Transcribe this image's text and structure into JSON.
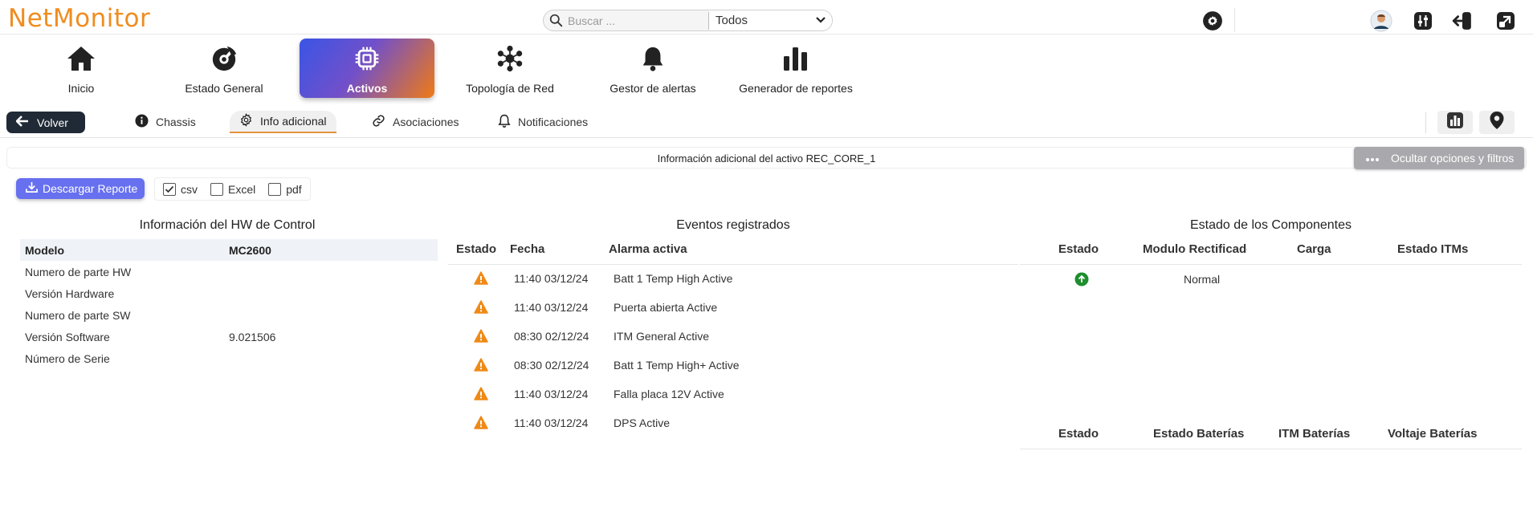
{
  "app": {
    "logo": "NetMonitor"
  },
  "search": {
    "placeholder": "Buscar ...",
    "filter": "Todos"
  },
  "nav": [
    {
      "label": "Inicio",
      "icon": "home-icon"
    },
    {
      "label": "Estado General",
      "icon": "gauge-icon"
    },
    {
      "label": "Activos",
      "icon": "chip-icon",
      "active": true
    },
    {
      "label": "Topología de Red",
      "icon": "network-icon"
    },
    {
      "label": "Gestor de alertas",
      "icon": "bell-icon"
    },
    {
      "label": "Generador de reportes",
      "icon": "bar-chart-icon"
    }
  ],
  "tabs": {
    "back": "Volver",
    "items": [
      {
        "label": "Chassis",
        "icon": "info-icon"
      },
      {
        "label": "Info adicional",
        "icon": "gear-icon",
        "active": true
      },
      {
        "label": "Asociaciones",
        "icon": "link-icon"
      },
      {
        "label": "Notificaciones",
        "icon": "bell-icon"
      }
    ]
  },
  "info": {
    "title": "Información adicional del activo REC_CORE_1",
    "hide_filters": "Ocultar opciones y filtros"
  },
  "export": {
    "download": "Descargar Reporte",
    "formats": [
      {
        "label": "csv",
        "checked": true
      },
      {
        "label": "Excel",
        "checked": false
      },
      {
        "label": "pdf",
        "checked": false
      }
    ]
  },
  "hw": {
    "title": "Información del HW de Control",
    "header": {
      "k": "Modelo",
      "v": "MC2600"
    },
    "rows": [
      {
        "k": "Numero de parte HW",
        "v": ""
      },
      {
        "k": "Versión Hardware",
        "v": ""
      },
      {
        "k": "Numero de parte SW",
        "v": ""
      },
      {
        "k": "Versión Software",
        "v": "9.021506"
      },
      {
        "k": "Número de Serie",
        "v": ""
      }
    ]
  },
  "events": {
    "title": "Eventos registrados",
    "columns": [
      "Estado",
      "Fecha",
      "Alarma activa"
    ],
    "rows": [
      {
        "fecha": "11:40 03/12/24",
        "alarma": "Batt 1 Temp High Active"
      },
      {
        "fecha": "11:40 03/12/24",
        "alarma": "Puerta abierta Active"
      },
      {
        "fecha": "08:30 02/12/24",
        "alarma": "ITM General Active"
      },
      {
        "fecha": "08:30 02/12/24",
        "alarma": "Batt 1 Temp High+ Active"
      },
      {
        "fecha": "11:40 03/12/24",
        "alarma": "Falla placa 12V Active"
      },
      {
        "fecha": "11:40 03/12/24",
        "alarma": "DPS Active"
      }
    ]
  },
  "components": {
    "title": "Estado de los Componentes",
    "columns1": [
      "Estado",
      "Modulo Rectificador",
      "Carga",
      "Estado ITMs"
    ],
    "row1": {
      "modulo": "Normal"
    },
    "columns2": [
      "Estado",
      "Estado Baterías",
      "ITM Baterías",
      "Voltaje Baterías"
    ]
  },
  "colors": {
    "brand": "#ef8d20",
    "warning": "#ef8a17",
    "ok": "#1e8e2e",
    "download": "#6770ef"
  }
}
